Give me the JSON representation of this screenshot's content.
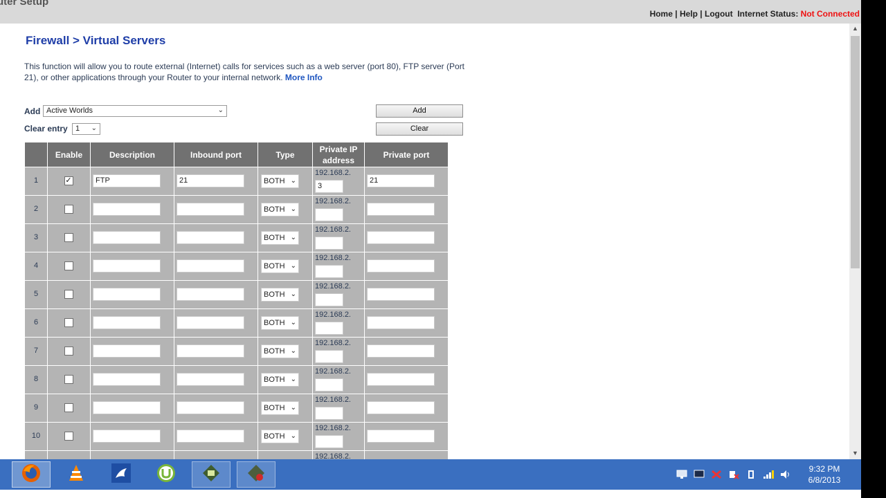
{
  "app_title": "uter Setup",
  "topnav": {
    "home": "Home",
    "sep1": " | ",
    "help": "Help",
    "sep2": " | ",
    "logout": "Logout",
    "status_label": "Internet Status: ",
    "status_value": "Not Connected"
  },
  "page_title": "Firewall > Virtual Servers",
  "intro": {
    "text": "This function will allow you to route external (Internet) calls for services such as a web server (port 80), FTP server (Port 21), or other applications through your Router to your internal network. ",
    "more_info": "More Info"
  },
  "add": {
    "label": "Add",
    "selected": "Active Worlds",
    "button": "Add"
  },
  "clear": {
    "label": "Clear entry",
    "selected": "1",
    "button": "Clear"
  },
  "table": {
    "headers": {
      "enable": "Enable",
      "description": "Description",
      "inbound": "Inbound port",
      "type": "Type",
      "private_ip": "Private IP address",
      "private_port": "Private port"
    },
    "ip_prefix": "192.168.2.",
    "rows": [
      {
        "num": "1",
        "enabled": true,
        "description": "FTP",
        "inbound": "21",
        "type": "BOTH",
        "ip_last": "3",
        "private_port": "21"
      },
      {
        "num": "2",
        "enabled": false,
        "description": "",
        "inbound": "",
        "type": "BOTH",
        "ip_last": "",
        "private_port": ""
      },
      {
        "num": "3",
        "enabled": false,
        "description": "",
        "inbound": "",
        "type": "BOTH",
        "ip_last": "",
        "private_port": ""
      },
      {
        "num": "4",
        "enabled": false,
        "description": "",
        "inbound": "",
        "type": "BOTH",
        "ip_last": "",
        "private_port": ""
      },
      {
        "num": "5",
        "enabled": false,
        "description": "",
        "inbound": "",
        "type": "BOTH",
        "ip_last": "",
        "private_port": ""
      },
      {
        "num": "6",
        "enabled": false,
        "description": "",
        "inbound": "",
        "type": "BOTH",
        "ip_last": "",
        "private_port": ""
      },
      {
        "num": "7",
        "enabled": false,
        "description": "",
        "inbound": "",
        "type": "BOTH",
        "ip_last": "",
        "private_port": ""
      },
      {
        "num": "8",
        "enabled": false,
        "description": "",
        "inbound": "",
        "type": "BOTH",
        "ip_last": "",
        "private_port": ""
      },
      {
        "num": "9",
        "enabled": false,
        "description": "",
        "inbound": "",
        "type": "BOTH",
        "ip_last": "",
        "private_port": ""
      },
      {
        "num": "10",
        "enabled": false,
        "description": "",
        "inbound": "",
        "type": "BOTH",
        "ip_last": "",
        "private_port": ""
      },
      {
        "num": "",
        "enabled": false,
        "description": "",
        "inbound": "",
        "type": "",
        "ip_last": "",
        "private_port": ""
      }
    ]
  },
  "taskbar": {
    "apps": [
      {
        "name": "firefox-icon",
        "state": "active"
      },
      {
        "name": "vlc-icon",
        "state": ""
      },
      {
        "name": "app-bird-icon",
        "state": ""
      },
      {
        "name": "utorrent-icon",
        "state": ""
      },
      {
        "name": "app-green-icon",
        "state": "running"
      },
      {
        "name": "app-red-icon",
        "state": "running"
      }
    ],
    "tray": [
      "action-center-icon",
      "monitor-icon",
      "flag-icon",
      "network-x-icon",
      "power-icon",
      "signal-icon",
      "volume-icon"
    ],
    "time": "9:32 PM",
    "date": "6/8/2013"
  }
}
